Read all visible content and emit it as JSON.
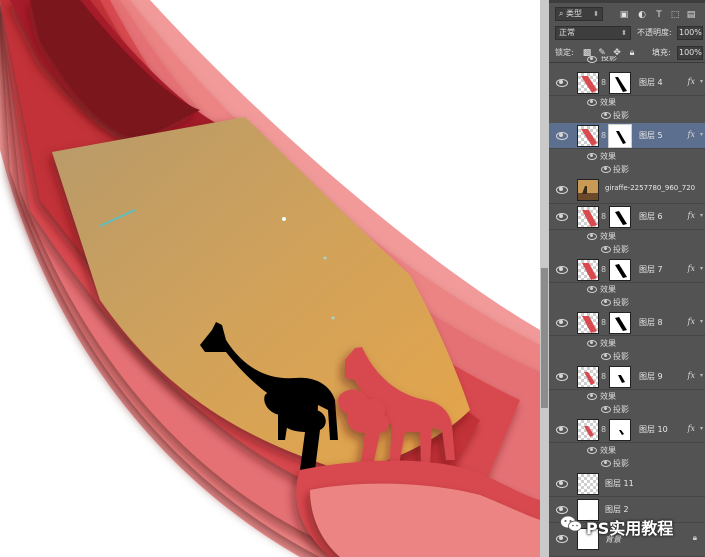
{
  "panel": {
    "filter": {
      "kind_label": "类型",
      "search_icon": "search-icon"
    },
    "blend_mode": "正常",
    "opacity_label": "不透明度:",
    "opacity_value": "100%",
    "lock_label": "锁定:",
    "fill_label": "填充:",
    "fill_value": "100%",
    "layers": [
      {
        "name": "图层 4",
        "fx": "fx",
        "effects_label": "效果",
        "effect": "投影",
        "selected": false
      },
      {
        "name": "图层 5",
        "fx": "fx",
        "effects_label": "效果",
        "effect": "投影",
        "selected": true
      },
      {
        "name": "giraffe-2257780_960_720"
      },
      {
        "name": "图层 6",
        "fx": "fx",
        "effects_label": "效果",
        "effect": "投影"
      },
      {
        "name": "图层 7",
        "fx": "fx",
        "effects_label": "效果",
        "effect": "投影"
      },
      {
        "name": "图层 8",
        "fx": "fx",
        "effects_label": "效果",
        "effect": "投影"
      },
      {
        "name": "图层 9",
        "fx": "fx",
        "effects_label": "效果",
        "effect": "投影"
      },
      {
        "name": "图层 10",
        "fx": "fx",
        "effects_label": "效果",
        "effect": "投影"
      },
      {
        "name": "图层 11"
      },
      {
        "name": "图层 2"
      },
      {
        "name": "背景"
      }
    ],
    "top_partial_effect": "投影"
  },
  "watermark": {
    "text": "PS实用教程"
  },
  "colors": {
    "panel_bg": "#535353",
    "selected_row": "#5d6f8e",
    "paper_dark_red": "#8c1b25",
    "paper_red": "#d84a4f",
    "paper_pink": "#ee8c8c",
    "paper_sand": "#c99a55"
  }
}
